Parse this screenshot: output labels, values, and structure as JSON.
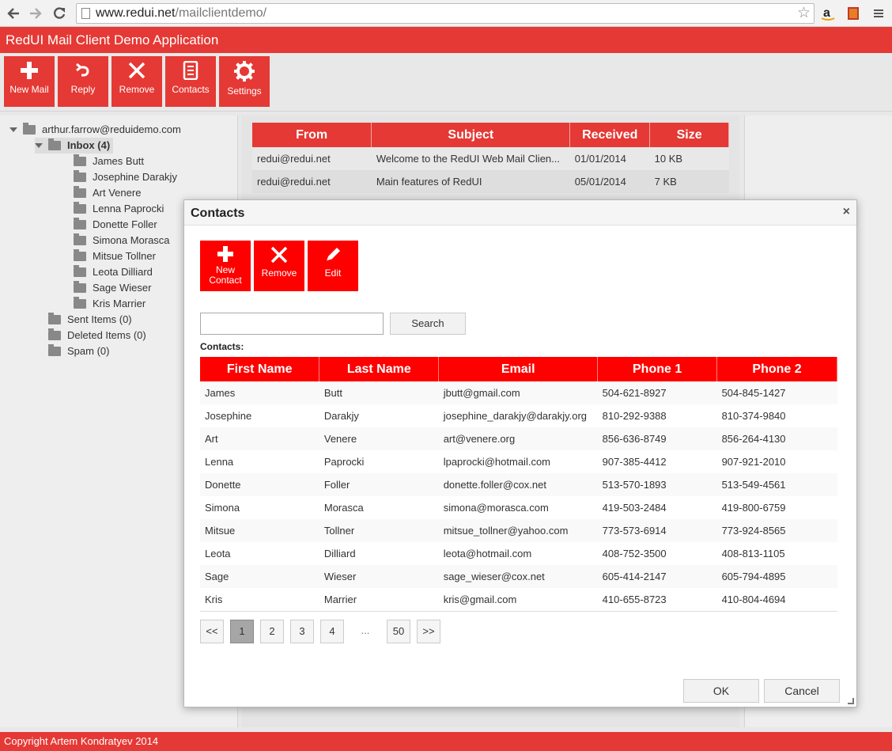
{
  "browser": {
    "url_host": "www.redui.net",
    "url_path": "/mailclientdemo/"
  },
  "app": {
    "title": "RedUI Mail Client Demo Application",
    "footer": "Copyright Artem Kondratyev 2014",
    "accent": "#e53935"
  },
  "toolbar": {
    "new_mail": "New Mail",
    "reply": "Reply",
    "remove": "Remove",
    "contacts": "Contacts",
    "settings": "Settings"
  },
  "tree": {
    "account": "arthur.farrow@reduidemo.com",
    "inbox": "Inbox (4)",
    "inbox_children": [
      "James Butt",
      "Josephine Darakjy",
      "Art Venere",
      "Lenna Paprocki",
      "Donette Foller",
      "Simona Morasca",
      "Mitsue Tollner",
      "Leota Dilliard",
      "Sage Wieser",
      "Kris Marrier"
    ],
    "sent": "Sent Items (0)",
    "deleted": "Deleted Items (0)",
    "spam": "Spam (0)"
  },
  "mail_grid": {
    "headers": [
      "From",
      "Subject",
      "Received",
      "Size"
    ],
    "rows": [
      [
        "redui@redui.net",
        "Welcome to the RedUI Web Mail Clien...",
        "01/01/2014",
        "10 KB"
      ],
      [
        "redui@redui.net",
        "Main features of RedUI",
        "05/01/2014",
        "7 KB"
      ]
    ]
  },
  "dialog": {
    "title": "Contacts",
    "close": "×",
    "new_contact_line1": "New",
    "new_contact_line2": "Contact",
    "remove": "Remove",
    "edit": "Edit",
    "search_value": "",
    "search_button": "Search",
    "contacts_label": "Contacts:",
    "headers": [
      "First Name",
      "Last Name",
      "Email",
      "Phone 1",
      "Phone 2"
    ],
    "rows": [
      [
        "James",
        "Butt",
        "jbutt@gmail.com",
        "504-621-8927",
        "504-845-1427"
      ],
      [
        "Josephine",
        "Darakjy",
        "josephine_darakjy@darakjy.org",
        "810-292-9388",
        "810-374-9840"
      ],
      [
        "Art",
        "Venere",
        "art@venere.org",
        "856-636-8749",
        "856-264-4130"
      ],
      [
        "Lenna",
        "Paprocki",
        "lpaprocki@hotmail.com",
        "907-385-4412",
        "907-921-2010"
      ],
      [
        "Donette",
        "Foller",
        "donette.foller@cox.net",
        "513-570-1893",
        "513-549-4561"
      ],
      [
        "Simona",
        "Morasca",
        "simona@morasca.com",
        "419-503-2484",
        "419-800-6759"
      ],
      [
        "Mitsue",
        "Tollner",
        "mitsue_tollner@yahoo.com",
        "773-573-6914",
        "773-924-8565"
      ],
      [
        "Leota",
        "Dilliard",
        "leota@hotmail.com",
        "408-752-3500",
        "408-813-1105"
      ],
      [
        "Sage",
        "Wieser",
        "sage_wieser@cox.net",
        "605-414-2147",
        "605-794-4895"
      ],
      [
        "Kris",
        "Marrier",
        "kris@gmail.com",
        "410-655-8723",
        "410-804-4694"
      ]
    ],
    "pager": {
      "first": "<<",
      "pages": [
        "1",
        "2",
        "3",
        "4"
      ],
      "ellipsis": "...",
      "last_page": "50",
      "last": ">>",
      "current": "1"
    },
    "ok": "OK",
    "cancel": "Cancel"
  }
}
